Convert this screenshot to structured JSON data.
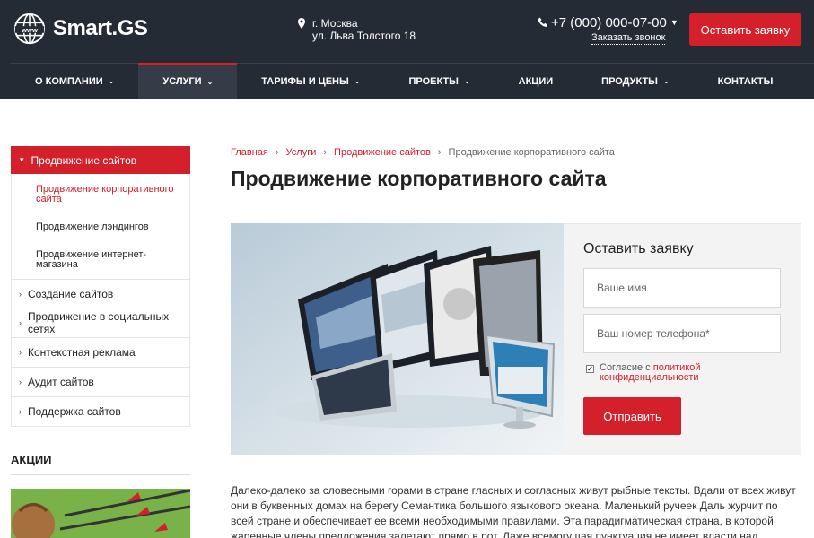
{
  "brand": {
    "name": "Smart.GS",
    "accent": "#d4202a",
    "header_bg": "#252b35"
  },
  "header": {
    "city": "г. Москва",
    "street": "ул. Льва Толстого 18",
    "phone": "+7 (000) 000-07-00",
    "callback": "Заказать звонок",
    "cta": "Оставить заявку"
  },
  "nav": {
    "items": [
      {
        "label": "О КОМПАНИИ",
        "chev": "⌄"
      },
      {
        "label": "УСЛУГИ",
        "chev": "⌄"
      },
      {
        "label": "ТАРИФЫ И ЦЕНЫ",
        "chev": "⌄"
      },
      {
        "label": "ПРОЕКТЫ",
        "chev": "⌄"
      },
      {
        "label": "АКЦИИ"
      },
      {
        "label": "ПРОДУКТЫ",
        "chev": "⌄"
      },
      {
        "label": "КОНТАКТЫ"
      }
    ]
  },
  "sidebar": {
    "head": "Продвижение сайтов",
    "sub": [
      "Продвижение корпоративного сайта",
      "Продвижение лэндингов",
      "Продвижение интернет-магазина"
    ],
    "items": [
      "Создание сайтов",
      "Продвижение в социальных сетях",
      "Контекстная реклама",
      "Аудит сайтов",
      "Поддержка сайтов"
    ]
  },
  "promo": {
    "title": "АКЦИИ"
  },
  "breadcrumb": [
    "Главная",
    "Услуги",
    "Продвижение сайтов",
    "Продвижение корпоративного сайта"
  ],
  "page_title": "Продвижение корпоративного сайта",
  "form": {
    "title": "Оставить заявку",
    "name_placeholder": "Ваше имя",
    "phone_placeholder": "Ваш номер телефона*",
    "consent_prefix": "Согласие с ",
    "consent_link": "политикой конфиденциальности",
    "submit": "Отправить"
  },
  "article": "Далеко-далеко за словесными горами в стране гласных и согласных живут рыбные тексты. Вдали от всех живут они в буквенных домах на берегу Семантика большого языкового океана. Маленький ручеек Даль журчит по всей стране и обеспечивает ее всеми необходимыми правилами. Эта парадигматическая страна, в которой жаренные члены предложения залетают прямо в рот. Даже всемогущая пунктуация не имеет власти над рыбными текстами"
}
